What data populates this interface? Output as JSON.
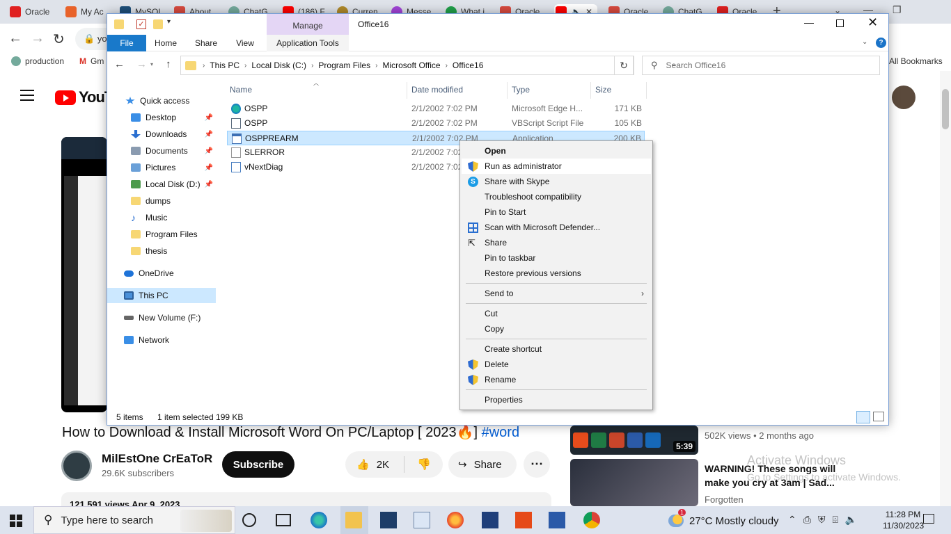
{
  "browser": {
    "tabs": [
      {
        "title": "Oracle",
        "color": "#e02020"
      },
      {
        "title": "My Ac",
        "color": "#e8622a"
      },
      {
        "title": "MySQL",
        "color": "#1e4f7a"
      },
      {
        "title": "About",
        "color": "#d84a3f"
      },
      {
        "title": "ChatG",
        "color": "#74aa9c"
      },
      {
        "title": "(186) F",
        "color": "#ff0000"
      },
      {
        "title": "Curren",
        "color": "#b08a2a"
      },
      {
        "title": "Messe",
        "color": "#a244d8"
      },
      {
        "title": "What i",
        "color": "#21a04a"
      },
      {
        "title": "Oracle",
        "color": "#d84a3f"
      },
      {
        "title": "",
        "color": "#ff0000"
      },
      {
        "title": "Oracle",
        "color": "#d84a3f"
      },
      {
        "title": "ChatG",
        "color": "#74aa9c"
      },
      {
        "title": "Oracle",
        "color": "#e02020"
      }
    ],
    "new_tab": "+",
    "address_prefix": "yo",
    "bookmarks": [
      {
        "label": "production",
        "color": "#74aa9c"
      },
      {
        "label": "Gm",
        "color": "#d93025"
      }
    ],
    "all_bookmarks": "All Bookmarks"
  },
  "youtube": {
    "logo_text": "YouTube",
    "video_title": "How to Download & Install Microsoft Word On PC/Laptop [ 2023🔥]",
    "video_tag": "#word",
    "channel_name": "MilEstOne CrEaToR",
    "subscribers": "29.6K subscribers",
    "subscribe_label": "Subscribe",
    "like_count": "2K",
    "share_label": "Share",
    "more_label": "⋯",
    "description": "121,591 views  Apr 9, 2023",
    "recommendations": [
      {
        "duration": "5:39",
        "meta": "502K views  •  2 months ago"
      },
      {
        "title": "WARNING! These songs will make you cry at 3am | Sad...",
        "channel": "Forgotten"
      }
    ],
    "watermark_title": "Activate Windows",
    "watermark_sub": "Go to Settings to activate Windows."
  },
  "explorer": {
    "title": "Office16",
    "manage_tab": "Manage",
    "ribbon_tabs": {
      "file": "File",
      "home": "Home",
      "share": "Share",
      "view": "View",
      "app_tools": "Application Tools"
    },
    "breadcrumbs": [
      "This PC",
      "Local Disk (C:)",
      "Program Files",
      "Microsoft Office",
      "Office16"
    ],
    "search_placeholder": "Search Office16",
    "nav_pane": [
      {
        "label": "Quick access",
        "icon": "star-icon",
        "color": "#3a8ee6"
      },
      {
        "label": "Desktop",
        "icon": "desktop-icon",
        "color": "#3a8ee6",
        "pinned": true
      },
      {
        "label": "Downloads",
        "icon": "download-icon",
        "color": "#2a6fd0",
        "pinned": true
      },
      {
        "label": "Documents",
        "icon": "documents-icon",
        "color": "#8a9bb0",
        "pinned": true
      },
      {
        "label": "Pictures",
        "icon": "pictures-icon",
        "color": "#6aa0d8",
        "pinned": true
      },
      {
        "label": "Local Disk (D:)",
        "icon": "drive-icon",
        "color": "#4c9a4c",
        "pinned": true
      },
      {
        "label": "dumps",
        "icon": "folder-icon",
        "color": "#f7d774"
      },
      {
        "label": "Music",
        "icon": "music-icon",
        "color": "#2a6fd0"
      },
      {
        "label": "Program Files",
        "icon": "folder-icon",
        "color": "#f7d774"
      },
      {
        "label": "thesis",
        "icon": "folder-icon",
        "color": "#f7d774"
      },
      {
        "label": "OneDrive",
        "icon": "cloud-icon",
        "color": "#1e73d8"
      },
      {
        "label": "This PC",
        "icon": "computer-icon",
        "color": "#4a90d9"
      },
      {
        "label": "New Volume (F:)",
        "icon": "drive-icon",
        "color": "#666666"
      },
      {
        "label": "Network",
        "icon": "network-icon",
        "color": "#3a8ee6"
      }
    ],
    "columns": {
      "name": "Name",
      "date": "Date modified",
      "type": "Type",
      "size": "Size"
    },
    "files": [
      {
        "name": "OSPP",
        "date": "2/1/2002 7:02 PM",
        "type": "Microsoft Edge H...",
        "size": "171 KB",
        "icon_color": "#1da1a0"
      },
      {
        "name": "OSPP",
        "date": "2/1/2002 7:02 PM",
        "type": "VBScript Script File",
        "size": "105 KB",
        "icon_color": "#5a6b7c"
      },
      {
        "name": "OSPPREARM",
        "date": "2/1/2002 7:02 PM",
        "type": "Application",
        "size": "200 KB",
        "icon_color": "#3d6fb3"
      },
      {
        "name": "SLERROR",
        "date": "2/1/2002 7:02",
        "type": "",
        "size": "",
        "icon_color": "#ffffff"
      },
      {
        "name": "vNextDiag",
        "date": "2/1/2002 7:02",
        "type": "",
        "size": "",
        "icon_color": "#4a7fc1"
      }
    ],
    "status_count": "5 items",
    "status_selected": "1 item selected  199 KB"
  },
  "context_menu": {
    "items": [
      {
        "label": "Open",
        "bold": true
      },
      {
        "label": "Run as administrator",
        "icon": "shield-icon",
        "hover": true
      },
      {
        "label": "Share with Skype",
        "icon": "skype-icon"
      },
      {
        "label": "Troubleshoot compatibility"
      },
      {
        "label": "Pin to Start"
      },
      {
        "label": "Scan with Microsoft Defender...",
        "icon": "defender-icon"
      },
      {
        "label": "Share",
        "icon": "share-icon"
      },
      {
        "label": "Pin to taskbar"
      },
      {
        "label": "Restore previous versions"
      },
      {
        "label": "Send to",
        "submenu": true
      },
      {
        "label": "Cut"
      },
      {
        "label": "Copy"
      },
      {
        "label": "Create shortcut"
      },
      {
        "label": "Delete",
        "icon": "shield-icon"
      },
      {
        "label": "Rename",
        "icon": "shield-icon"
      },
      {
        "label": "Properties"
      }
    ]
  },
  "taskbar": {
    "search_placeholder": "Type here to search",
    "weather": "27°C  Mostly cloudy",
    "weather_badge": "1",
    "time": "11:28 PM",
    "date": "11/30/2023"
  }
}
